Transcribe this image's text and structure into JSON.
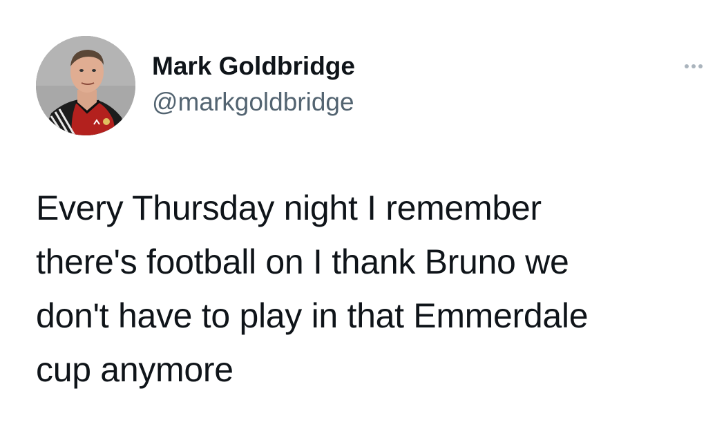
{
  "author": {
    "display_name": "Mark Goldbridge",
    "handle": "@markgoldbridge",
    "avatar_icon": "profile-photo"
  },
  "more_menu": {
    "icon": "more-horizontal-icon"
  },
  "tweet": {
    "lines": [
      "Every Thursday night I remember",
      "there's football on I thank Bruno we",
      "don't have to play in that Emmerdale",
      "cup anymore"
    ]
  },
  "colors": {
    "text_primary": "#0f1419",
    "text_secondary": "#536471",
    "background": "#ffffff"
  }
}
